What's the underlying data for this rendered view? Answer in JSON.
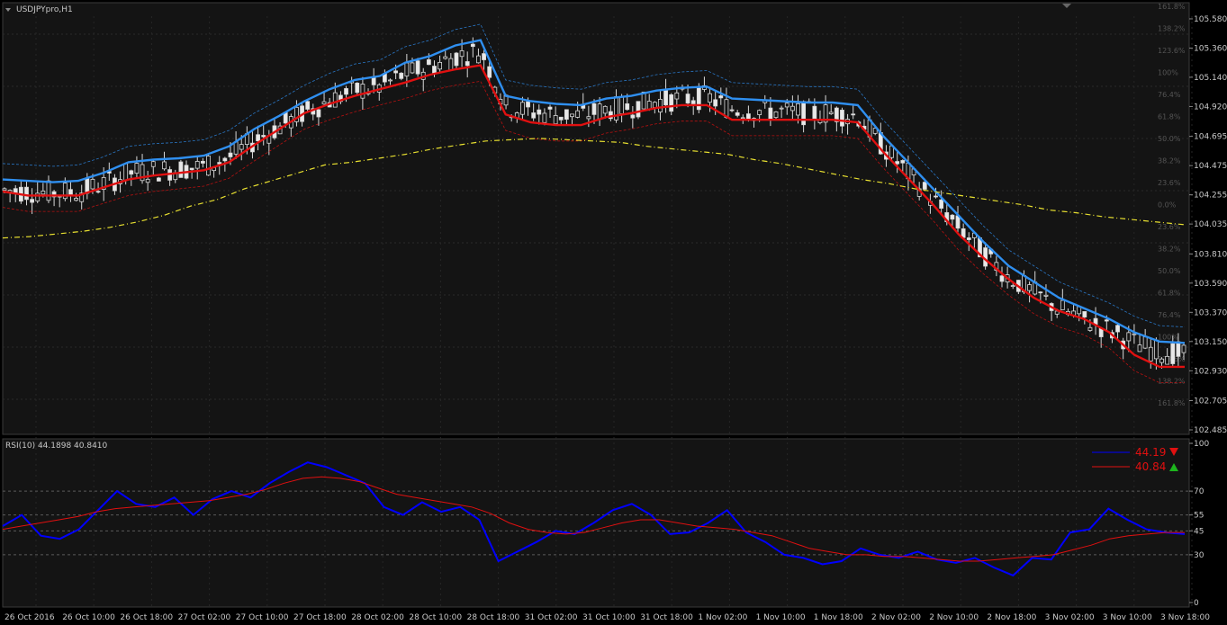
{
  "chart_data": [
    {
      "type": "candlestick",
      "title": "USDJPYpro,H1",
      "ylim": [
        102.485,
        105.6
      ],
      "y_ticks": [
        "105.580",
        "105.360",
        "105.140",
        "104.920",
        "104.695",
        "104.475",
        "104.255",
        "104.035",
        "103.810",
        "103.590",
        "103.370",
        "103.150",
        "102.930",
        "102.705",
        "102.485"
      ],
      "fib_levels": [
        "161.8%",
        "138.2%",
        "123.6%",
        "100%",
        "76.4%",
        "61.8%",
        "50.0%",
        "38.2%",
        "23.6%",
        "0.0%",
        "23.6%",
        "38.2%",
        "50.0%",
        "61.8%",
        "76.4%",
        "100%",
        "123.6%",
        "138.2%",
        "161.8%"
      ],
      "x_labels": [
        "26 Oct 2016",
        "26 Oct 10:00",
        "26 Oct 18:00",
        "27 Oct 02:00",
        "27 Oct 10:00",
        "27 Oct 18:00",
        "28 Oct 02:00",
        "28 Oct 10:00",
        "28 Oct 18:00",
        "31 Oct 02:00",
        "31 Oct 10:00",
        "31 Oct 18:00",
        "1 Nov 02:00",
        "1 Nov 10:00",
        "1 Nov 18:00",
        "2 Nov 02:00",
        "2 Nov 10:00",
        "2 Nov 18:00",
        "3 Nov 02:00",
        "3 Nov 10:00",
        "3 Nov 18:00"
      ],
      "series": [
        {
          "name": "blue_ma",
          "color": "#2f8ff0",
          "values": [
            104.37,
            104.36,
            104.35,
            104.36,
            104.42,
            104.5,
            104.52,
            104.53,
            104.55,
            104.62,
            104.75,
            104.85,
            104.96,
            105.05,
            105.12,
            105.15,
            105.25,
            105.3,
            105.38,
            105.42,
            105.0,
            104.96,
            104.94,
            104.93,
            104.98,
            105.0,
            105.04,
            105.06,
            105.07,
            104.98,
            104.97,
            104.96,
            104.95,
            104.95,
            104.93,
            104.7,
            104.5,
            104.3,
            104.1,
            103.9,
            103.72,
            103.6,
            103.48,
            103.4,
            103.32,
            103.22,
            103.15,
            103.14
          ]
        },
        {
          "name": "red_ma",
          "color": "#e01010",
          "values": [
            104.28,
            104.25,
            104.25,
            104.25,
            104.31,
            104.37,
            104.4,
            104.42,
            104.44,
            104.5,
            104.63,
            104.75,
            104.87,
            104.94,
            105.0,
            105.05,
            105.1,
            105.16,
            105.2,
            105.23,
            104.86,
            104.8,
            104.78,
            104.78,
            104.84,
            104.87,
            104.91,
            104.93,
            104.93,
            104.82,
            104.82,
            104.82,
            104.82,
            104.82,
            104.8,
            104.58,
            104.38,
            104.18,
            103.96,
            103.78,
            103.62,
            103.48,
            103.38,
            103.32,
            103.22,
            103.05,
            102.96,
            102.96
          ]
        },
        {
          "name": "yellow_ma",
          "color": "#e8e030",
          "values": [
            103.93,
            103.94,
            103.96,
            103.98,
            104.01,
            104.05,
            104.1,
            104.17,
            104.22,
            104.3,
            104.36,
            104.42,
            104.48,
            104.5,
            104.53,
            104.56,
            104.6,
            104.63,
            104.66,
            104.67,
            104.68,
            104.67,
            104.66,
            104.65,
            104.62,
            104.6,
            104.58,
            104.56,
            104.52,
            104.49,
            104.45,
            104.41,
            104.37,
            104.34,
            104.3,
            104.27,
            104.24,
            104.21,
            104.18,
            104.14,
            104.12,
            104.09,
            104.07,
            104.05,
            104.03
          ]
        }
      ]
    },
    {
      "type": "line",
      "title": "RSI(10) 44.1898 40.8410",
      "ylim": [
        0,
        100
      ],
      "y_ticks": [
        "100",
        "70",
        "55",
        "45",
        "30",
        "0"
      ],
      "legend": {
        "position": "top-right"
      },
      "series": [
        {
          "name": "RSI",
          "color": "#0000ff",
          "last": "44.19",
          "direction": "down",
          "values": [
            48,
            55,
            42,
            40,
            46,
            58,
            70,
            62,
            60,
            66,
            55,
            65,
            70,
            66,
            75,
            82,
            88,
            85,
            80,
            75,
            60,
            55,
            63,
            57,
            60,
            52,
            26,
            32,
            38,
            45,
            43,
            50,
            58,
            62,
            55,
            43,
            44,
            50,
            58,
            44,
            38,
            30,
            28,
            24,
            26,
            34,
            30,
            28,
            32,
            27,
            25,
            28,
            22,
            17,
            28,
            27,
            44,
            46,
            59,
            52,
            46,
            44,
            43
          ]
        },
        {
          "name": "Signal",
          "color": "#e01010",
          "last": "40.84",
          "direction": "up",
          "values": [
            46,
            48,
            50,
            52,
            54,
            57,
            59,
            60,
            61,
            62,
            63,
            64,
            66,
            68,
            71,
            75,
            78,
            79,
            78,
            76,
            72,
            68,
            66,
            64,
            62,
            60,
            56,
            50,
            46,
            44,
            43,
            44,
            47,
            50,
            52,
            52,
            50,
            48,
            47,
            46,
            44,
            42,
            38,
            34,
            32,
            30,
            30,
            29,
            29,
            28,
            27,
            26,
            26,
            27,
            28,
            29,
            30,
            33,
            36,
            40,
            42,
            43,
            44,
            44
          ]
        }
      ]
    }
  ]
}
